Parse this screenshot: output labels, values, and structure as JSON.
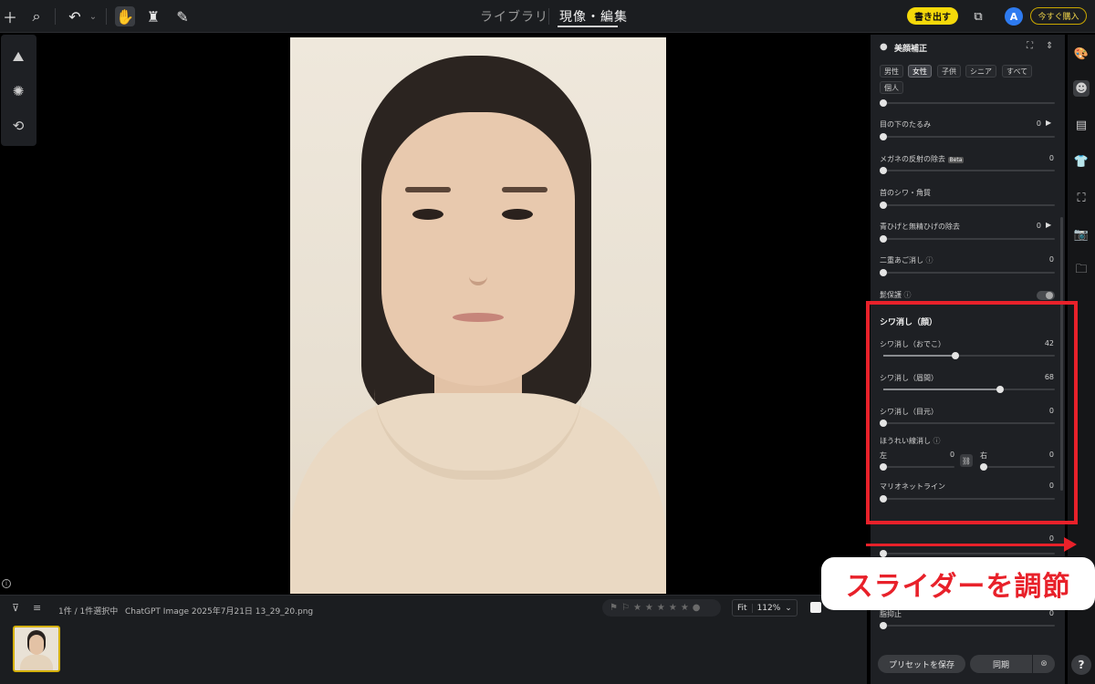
{
  "topbar": {
    "tabs": [
      {
        "label": "ライブラリ",
        "active": false
      },
      {
        "label": "現像・編集",
        "active": true
      }
    ],
    "export_label": "書き出す",
    "avatar_initial": "A",
    "buy_label": "今すぐ購入"
  },
  "bottombar": {
    "selection_text": "1件 / 1件選択中",
    "filename": "ChatGPT Image 2025年7月21日 13_29_20.png",
    "fit_label": "Fit",
    "zoom_value": "112%"
  },
  "panel": {
    "title": "美顔補正",
    "chips": [
      "男性",
      "女性",
      "子供",
      "シニア",
      "すべて",
      "個人"
    ],
    "active_chip": "女性",
    "sliders_top": [
      {
        "label": "目の下のたるみ",
        "value": "0",
        "fraction": 0.0,
        "has_arrow": true
      },
      {
        "label": "メガネの反射の除去",
        "badge": "Beta",
        "value": "0",
        "fraction": 0.0
      },
      {
        "label": "首のシワ・角質",
        "value": "",
        "fraction": 0.0
      },
      {
        "label": "青ひげと無精ひげの除去",
        "value": "0",
        "fraction": 0.0,
        "has_arrow": true
      },
      {
        "label": "二重あご消し",
        "value": "0",
        "fraction": 0.0
      }
    ],
    "toggle_label": "髭保護",
    "section_title": "シワ消し（顔）",
    "sliders_wrinkle": [
      {
        "label": "シワ消し（おでこ）",
        "value": "42",
        "fraction": 0.42
      },
      {
        "label": "シワ消し（眉間）",
        "value": "68",
        "fraction": 0.68
      },
      {
        "label": "シワ消し（目元）",
        "value": "0",
        "fraction": 0.0
      }
    ],
    "nasolabial": {
      "label": "ほうれい線消し",
      "left_label": "左",
      "left_value": "0",
      "right_label": "右",
      "right_value": "0"
    },
    "marionette": {
      "label": "マリオネットライン",
      "value": "0"
    },
    "hidden_rows": [
      {
        "label": "",
        "value": "0"
      },
      {
        "label": "脂抑止",
        "value": "0"
      }
    ],
    "preset_label": "プリセットを保存",
    "sync_label": "同期"
  },
  "annotation": {
    "callout_text": "スライダーを調節",
    "accent": "#e8212a"
  },
  "colors": {
    "export_yellow": "#f5d90a",
    "avatar_blue": "#2e7bf0"
  }
}
